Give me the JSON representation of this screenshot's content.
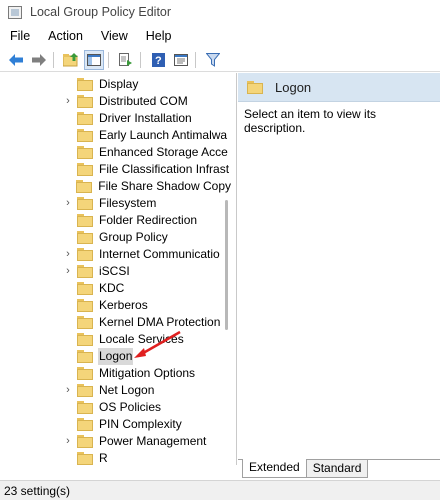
{
  "window": {
    "title": "Local Group Policy Editor"
  },
  "menu": [
    {
      "label": "File"
    },
    {
      "label": "Action"
    },
    {
      "label": "View"
    },
    {
      "label": "Help"
    }
  ],
  "toolbar": {
    "buttons": [
      {
        "icon": "back-arrow-icon"
      },
      {
        "icon": "forward-arrow-icon"
      },
      {
        "icon": "up-folder-icon"
      },
      {
        "icon": "show-hide-tree-icon"
      },
      {
        "icon": "export-list-icon"
      },
      {
        "icon": "help-icon"
      },
      {
        "icon": "properties-icon"
      },
      {
        "icon": "filter-icon"
      }
    ]
  },
  "tree": {
    "items": [
      {
        "label": "Display",
        "expandable": false
      },
      {
        "label": "Distributed COM",
        "expandable": true
      },
      {
        "label": "Driver Installation",
        "expandable": false
      },
      {
        "label": "Early Launch Antimalwa",
        "expandable": false
      },
      {
        "label": "Enhanced Storage Acce",
        "expandable": false
      },
      {
        "label": "File Classification Infrast",
        "expandable": false
      },
      {
        "label": "File Share Shadow Copy",
        "expandable": false
      },
      {
        "label": "Filesystem",
        "expandable": true
      },
      {
        "label": "Folder Redirection",
        "expandable": false
      },
      {
        "label": "Group Policy",
        "expandable": false
      },
      {
        "label": "Internet Communicatio",
        "expandable": true
      },
      {
        "label": "iSCSI",
        "expandable": true
      },
      {
        "label": "KDC",
        "expandable": false
      },
      {
        "label": "Kerberos",
        "expandable": false
      },
      {
        "label": "Kernel DMA Protection",
        "expandable": false
      },
      {
        "label": "Locale Services",
        "expandable": false
      },
      {
        "label": "Logon",
        "expandable": false,
        "selected": true
      },
      {
        "label": "Mitigation Options",
        "expandable": false
      },
      {
        "label": "Net Logon",
        "expandable": true
      },
      {
        "label": "OS Policies",
        "expandable": false
      },
      {
        "label": "PIN Complexity",
        "expandable": false
      },
      {
        "label": "Power Management",
        "expandable": true
      },
      {
        "label": "R",
        "expandable": false
      }
    ]
  },
  "details": {
    "title": "Logon",
    "description": "Select an item to view its description."
  },
  "tabs": [
    {
      "label": "Extended",
      "active": true
    },
    {
      "label": "Standard",
      "active": false
    }
  ],
  "status": {
    "text": "23 setting(s)"
  },
  "colors": {
    "header_bg": "#d7e5f2",
    "folder": "#f4d57a",
    "annotation_arrow": "#e02020"
  }
}
